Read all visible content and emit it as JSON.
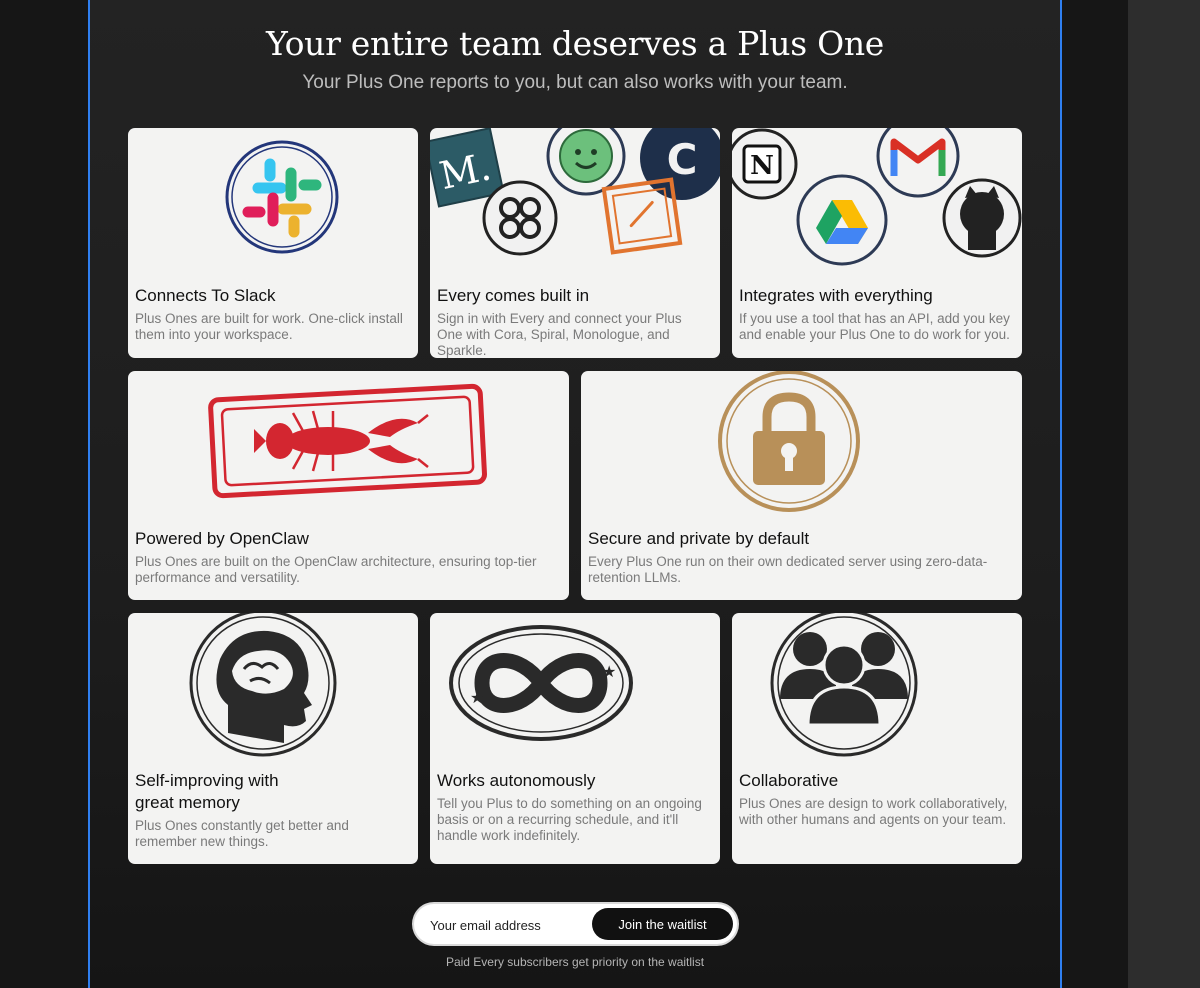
{
  "header": {
    "title": "Your entire team deserves a Plus One",
    "subtitle": "Your Plus One reports to you, but can also works with your team."
  },
  "cards": [
    {
      "title": "Connects To Slack",
      "description": "Plus Ones are built for work. One-click install them into your workspace.",
      "icon": "slack-stamp-icon"
    },
    {
      "title": "Every comes built in",
      "description": "Sign in with Every and connect your Plus One with Cora, Spiral, Monologue, and Sparkle.",
      "icon": "every-apps-stamps-icon",
      "stamps": [
        "M.",
        "C"
      ]
    },
    {
      "title": "Integrates with everything",
      "description": "If you use a tool that has an API, add you key and enable your Plus One to do work for you.",
      "icon": "integrations-stamps-icon",
      "stamps": [
        "N"
      ]
    },
    {
      "title": "Powered by OpenClaw",
      "description": "Plus Ones are built on the OpenClaw architecture, ensuring top-tier performance and versatility.",
      "icon": "lobster-stamp-icon"
    },
    {
      "title": "Secure and private by default",
      "description": "Every Plus One run on their own dedicated server using zero-data-retention LLMs.",
      "icon": "padlock-stamp-icon"
    },
    {
      "title": "Self-improving with great memory",
      "description": "Plus Ones constantly get better and remember new things.",
      "icon": "brain-stamp-icon"
    },
    {
      "title": "Works autonomously",
      "description": "Tell you Plus to do something on an ongoing basis or on a recurring schedule, and it'll handle work indefinitely.",
      "icon": "infinity-stamp-icon"
    },
    {
      "title": "Collaborative",
      "description": "Plus Ones are design to work collaboratively, with other humans and agents on your team.",
      "icon": "people-stamp-icon"
    }
  ],
  "signup": {
    "placeholder": "Your email address",
    "button_label": "Join the waitlist",
    "note": "Paid Every subscribers get priority on the waitlist"
  },
  "colors": {
    "frame_border": "#2f7ff0",
    "card_bg": "#f3f3f2",
    "slack_blue": "#36c5f0",
    "slack_green": "#2eb67d",
    "slack_yellow": "#ecb22e",
    "slack_red": "#e01e5a",
    "lobster_red": "#d32630",
    "lock_gold": "#b89059"
  }
}
